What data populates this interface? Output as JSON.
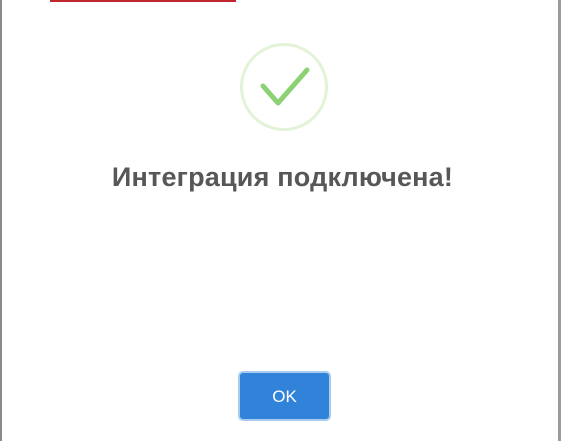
{
  "dialog": {
    "title": "Интеграция подключена!",
    "confirm_label": "OK",
    "icon": "check-icon"
  },
  "colors": {
    "accent": "#3083d8",
    "success": "#8cd274",
    "title": "#575757"
  }
}
